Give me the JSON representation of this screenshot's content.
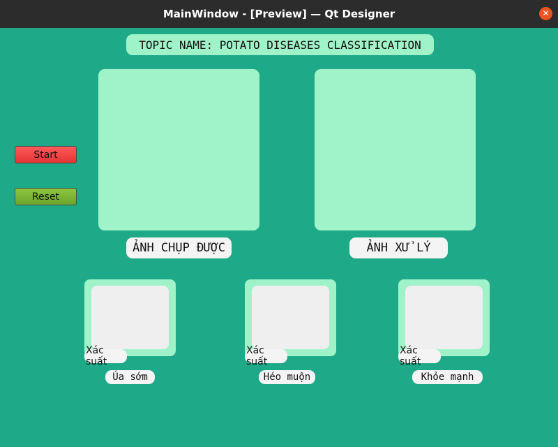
{
  "window": {
    "title": "MainWindow - [Preview] — Qt Designer",
    "close_glyph": "✕"
  },
  "topic": "TOPIC NAME: POTATO DISEASES CLASSIFICATION",
  "panels": {
    "captured_label": "ẢNH CHỤP ĐƯỢC",
    "processed_label": "ẢNH XỬ LÝ"
  },
  "buttons": {
    "start": "Start",
    "reset": "Reset"
  },
  "classes": [
    {
      "prob_label": "Xác suất",
      "name": "Úa sớm"
    },
    {
      "prob_label": "Xác suất",
      "name": "Héo muộn"
    },
    {
      "prob_label": "Xác suất",
      "name": "Khỏe mạnh"
    }
  ],
  "colors": {
    "background": "#1eaa88",
    "panel": "#a0f2c8",
    "start": "#f04848",
    "reset": "#7ab838",
    "close": "#e95420"
  }
}
